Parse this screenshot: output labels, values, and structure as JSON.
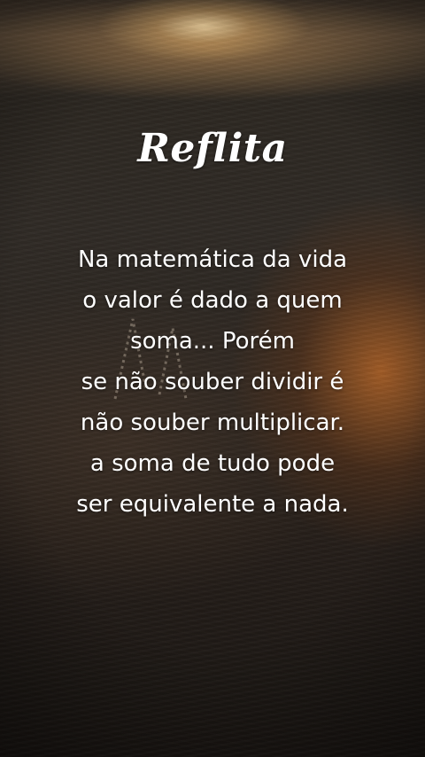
{
  "title": "Reflita",
  "quote": {
    "lines": [
      "Na matemática da vida",
      "o valor é dado a quem",
      "soma... Porém",
      "se não souber dividir é",
      "não souber multiplicar.",
      "a soma de tudo pode",
      "ser equivalente a nada."
    ]
  },
  "colors": {
    "text": "#ffffff",
    "sunlight": "#ffe1aa",
    "sand_dark": "#1a1512",
    "warm_glow": "#c86e28"
  },
  "background": {
    "scene": "sand-beach-sunset"
  }
}
